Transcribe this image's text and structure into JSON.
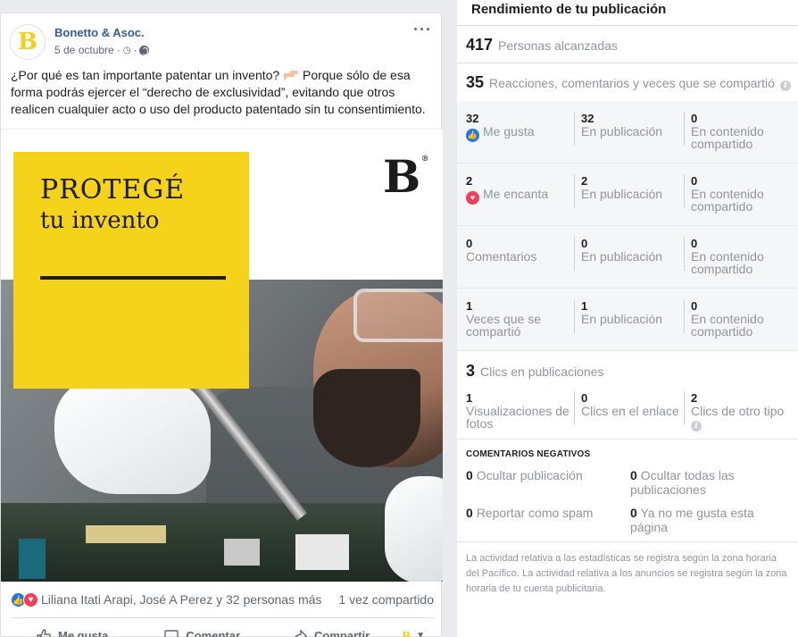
{
  "post": {
    "avatar_letter": "B",
    "page_name": "Bonetto & Asoc.",
    "date": "5 de octubre",
    "meta_sep": "·",
    "text_before": "¿Por qué es tan importante patentar un invento?",
    "text_after": "Porque sólo de esa forma podrás ejercer el “derecho de exclusividad”, evitando que otros realicen cualquier acto o uso del producto patentado sin tu consentimiento.",
    "image": {
      "headline": "PROTEGÉ",
      "subline": "tu invento",
      "brand_letter": "B",
      "brand_reg": "®"
    },
    "reactors": "Liliana Itati Arapi, José A Perez y 32 personas más",
    "shares": "1 vez compartido",
    "actions": {
      "like": "Me gusta",
      "comment": "Comentar",
      "share": "Compartir"
    },
    "as_page_letter": "B"
  },
  "insights": {
    "title": "Rendimiento de tu publicación",
    "reach": {
      "value": "417",
      "label": "Personas alcanzadas"
    },
    "engagement": {
      "value": "35",
      "label": "Reacciones, comentarios y veces que se compartió"
    },
    "rows": [
      {
        "total": "32",
        "label": "Me gusta",
        "icon": "like-icon",
        "on_post": "32",
        "on_post_label": "En publicación",
        "on_shares": "0",
        "on_shares_label": "En contenido compartido"
      },
      {
        "total": "2",
        "label": "Me encanta",
        "icon": "love-icon",
        "on_post": "2",
        "on_post_label": "En publicación",
        "on_shares": "0",
        "on_shares_label": "En contenido compartido"
      },
      {
        "total": "0",
        "label": "Comentarios",
        "icon": "",
        "on_post": "0",
        "on_post_label": "En publicación",
        "on_shares": "0",
        "on_shares_label": "En contenido compartido"
      },
      {
        "total": "1",
        "label": "Veces que se compartió",
        "icon": "",
        "on_post": "1",
        "on_post_label": "En publicación",
        "on_shares": "0",
        "on_shares_label": "En contenido compartido"
      }
    ],
    "clicks": {
      "value": "3",
      "label": "Clics en publicaciones",
      "cols": [
        {
          "value": "1",
          "label": "Visualizaciones de fotos"
        },
        {
          "value": "0",
          "label": "Clics en el enlace"
        },
        {
          "value": "2",
          "label": "Clics de otro tipo"
        }
      ]
    },
    "negative": {
      "title": "COMENTARIOS NEGATIVOS",
      "items": [
        {
          "value": "0",
          "label": "Ocultar publicación"
        },
        {
          "value": "0",
          "label": "Ocultar todas las publicaciones"
        },
        {
          "value": "0",
          "label": "Reportar como spam"
        },
        {
          "value": "0",
          "label": "Ya no me gusta esta página"
        }
      ]
    },
    "footnote": "La actividad relativa a las estadísticas se registra según la zona horaria del Pacífico. La actividad relativa a los anuncios se registra según la zona horaria de tu cuenta publicitaria."
  },
  "colors": {
    "brand_yellow": "#f6d31b",
    "link_blue": "#385898",
    "like_blue": "#1877f2",
    "love_red": "#f33e58"
  }
}
